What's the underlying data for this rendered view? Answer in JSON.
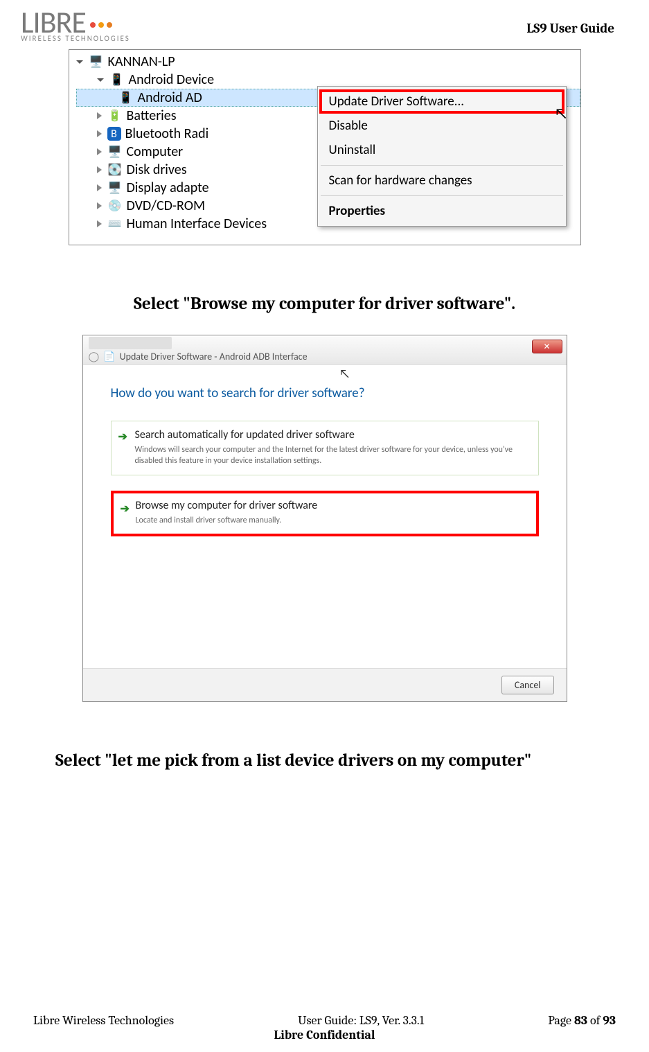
{
  "header": {
    "logo_main": "LIBRE",
    "logo_sub": "WIRELESS TECHNOLOGIES",
    "doc_title": "LS9 User Guide"
  },
  "device_tree": {
    "root": "KANNAN-LP",
    "items": [
      "Android Device",
      "Android AD",
      "Batteries",
      "Bluetooth Radi",
      "Computer",
      "Disk drives",
      "Display adapte",
      "DVD/CD-ROM",
      "Human Interface Devices"
    ]
  },
  "context_menu": {
    "update": "Update Driver Software...",
    "disable": "Disable",
    "uninstall": "Uninstall",
    "scan": "Scan for hardware changes",
    "properties": "Properties"
  },
  "instruction1": "Select \"Browse my computer for driver software\".",
  "wizard": {
    "title": "Update Driver Software - Android ADB Interface",
    "heading": "How do you want to search for driver software?",
    "option1_title": "Search automatically for updated driver software",
    "option1_desc": "Windows will search your computer and the Internet for the latest driver software for your device, unless you've disabled this feature in your device installation settings.",
    "option2_title": "Browse my computer for driver software",
    "option2_desc": "Locate and install driver software manually.",
    "cancel": "Cancel"
  },
  "instruction2": "Select \"let me pick from a list device drivers on my computer\"",
  "footer": {
    "left": "Libre Wireless Technologies",
    "center": "User Guide: LS9, Ver. 3.3.1",
    "page_label_pre": "Page ",
    "page_cur": "83",
    "page_of": " of ",
    "page_total": "93",
    "confidential": "Libre Confidential"
  }
}
